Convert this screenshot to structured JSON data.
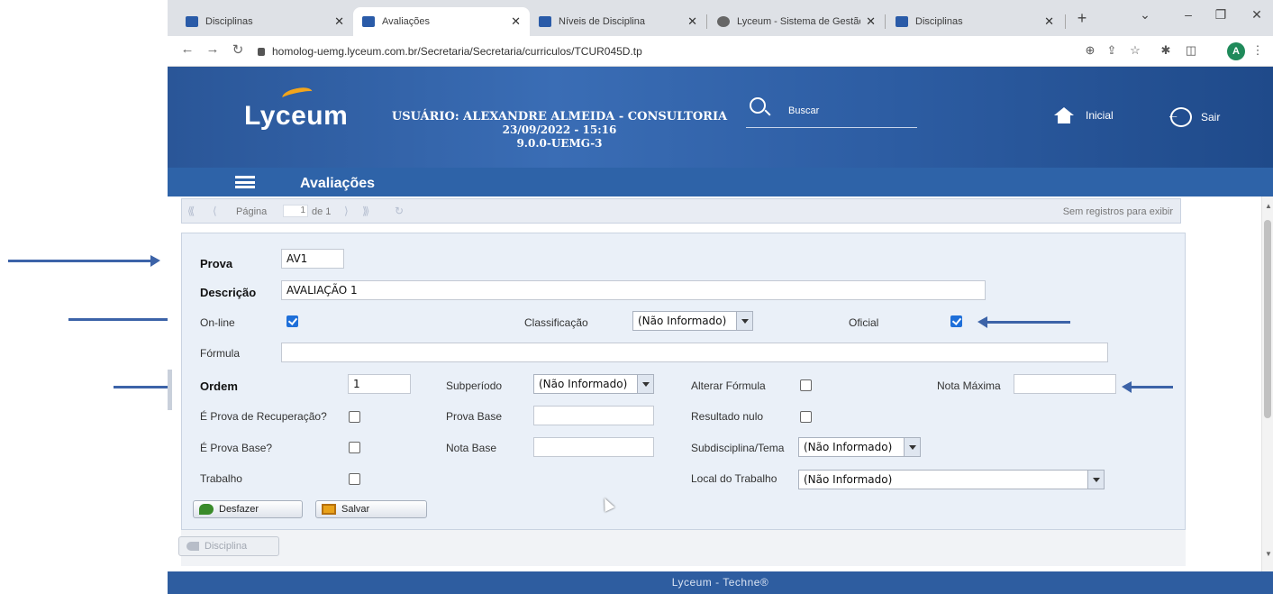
{
  "browser": {
    "tabs": [
      {
        "title": "Disciplinas",
        "active": false
      },
      {
        "title": "Avaliações",
        "active": true
      },
      {
        "title": "Níveis de Disciplina",
        "active": false
      },
      {
        "title": "Lyceum - Sistema de Gestão",
        "active": false
      },
      {
        "title": "Disciplinas",
        "active": false
      }
    ],
    "url": "homolog-uemg.lyceum.com.br/Secretaria/Secretaria/curriculos/TCUR045D.tp",
    "profile_initial": "A"
  },
  "header": {
    "logo_text": "Lyceum",
    "user_line": "USUÁRIO: ALEXANDRE ALMEIDA - CONSULTORIA",
    "datetime": "23/09/2022 - 15:16",
    "version": "9.0.0-UEMG-3",
    "search_label": "Buscar",
    "home_label": "Inicial",
    "logout_label": "Sair",
    "page_title": "Avaliações"
  },
  "pager": {
    "page_label": "Página",
    "page_value": "1",
    "of_label": "de 1",
    "empty_text": "Sem registros para exibir"
  },
  "form": {
    "prova_label": "Prova",
    "prova_value": "AV1",
    "descricao_label": "Descrição",
    "descricao_value": "AVALIAÇÃO 1",
    "online_label": "On-line",
    "online_checked": true,
    "classificacao_label": "Classificação",
    "classificacao_value": "(Não Informado)",
    "oficial_label": "Oficial",
    "oficial_checked": true,
    "formula_label": "Fórmula",
    "formula_value": "",
    "ordem_label": "Ordem",
    "ordem_value": "1",
    "subperiodo_label": "Subperíodo",
    "subperiodo_value": "(Não Informado)",
    "alterar_formula_label": "Alterar Fórmula",
    "nota_maxima_label": "Nota Máxima",
    "nota_maxima_value": "",
    "recuperacao_label": "É Prova de Recuperação?",
    "prova_base_label": "Prova Base",
    "prova_base_value": "",
    "resultado_nulo_label": "Resultado nulo",
    "e_prova_base_label": "É Prova Base?",
    "nota_base_label": "Nota Base",
    "nota_base_value": "",
    "subdisciplina_label": "Subdisciplina/Tema",
    "subdisciplina_value": "(Não Informado)",
    "trabalho_label": "Trabalho",
    "local_trabalho_label": "Local do Trabalho",
    "local_trabalho_value": "(Não Informado)"
  },
  "actions": {
    "undo_label": "Desfazer",
    "save_label": "Salvar",
    "discipline_label": "Disciplina"
  },
  "footer": {
    "text": "Lyceum - Techne®"
  },
  "colors": {
    "header_blue": "#2e63a8",
    "panel_bg": "#eaf0f8",
    "checkbox_blue": "#1e6fd9",
    "arrow_blue": "#3c63a8"
  }
}
